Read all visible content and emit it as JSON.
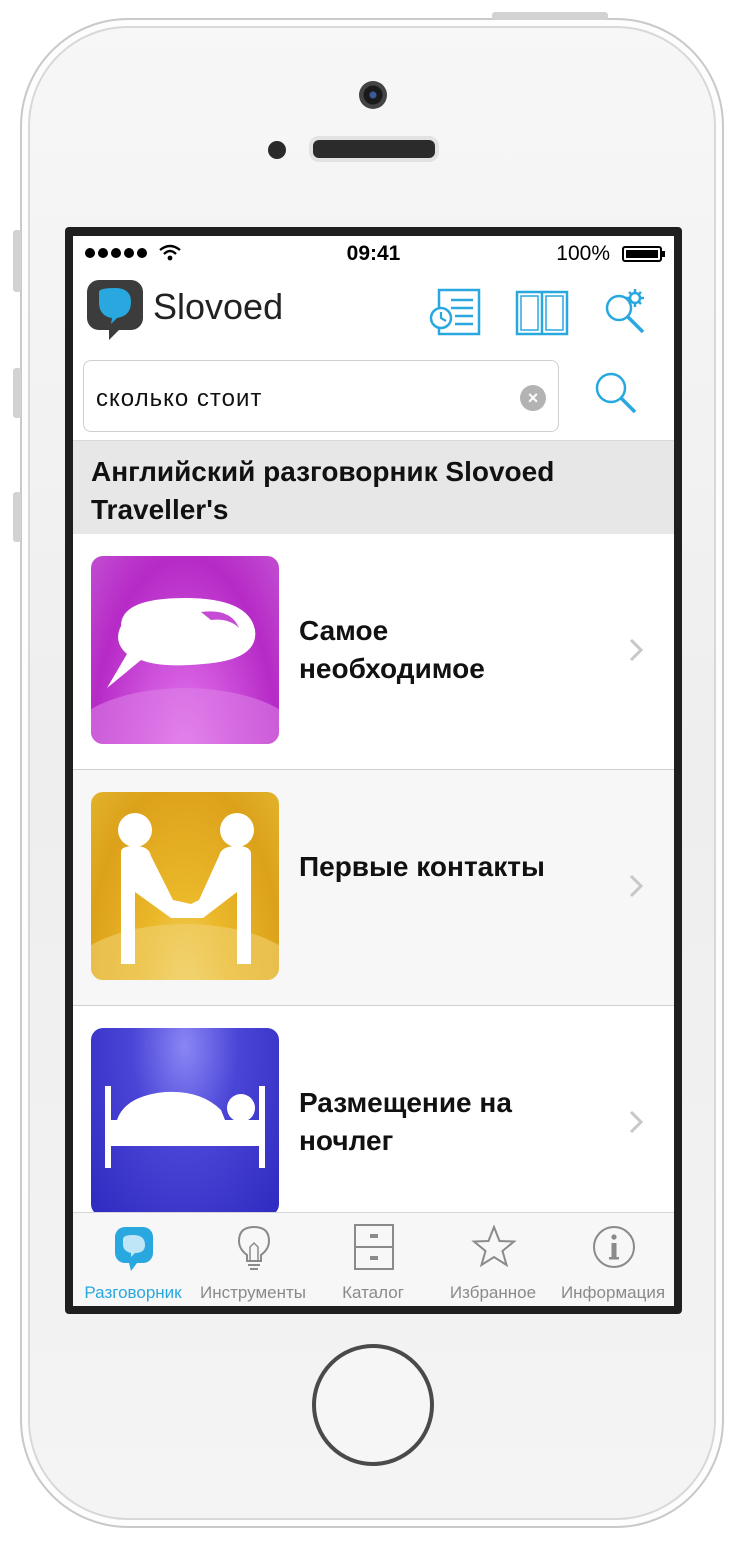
{
  "status_bar": {
    "time": "09:41",
    "battery": "100%"
  },
  "app": {
    "brand": "Slovoed"
  },
  "toolbar": {
    "history_icon": "history-list-icon",
    "book_icon": "book-icon",
    "settings_search_icon": "search-settings-icon"
  },
  "search": {
    "value": "сколько стоит",
    "clear_icon": "clear-icon",
    "button_icon": "search-icon"
  },
  "section": {
    "title": "Английский разговорник Slovoed Traveller's"
  },
  "categories": [
    {
      "title_line1": "Самое",
      "title_line2": "необходимое",
      "icon": "speech-bubble-icon",
      "color": "#c83fd6"
    },
    {
      "title_line1": "Первые контакты",
      "title_line2": "",
      "icon": "handshake-icon",
      "color": "#e6b021"
    },
    {
      "title_line1": "Размещение на",
      "title_line2": "ночлег",
      "icon": "bed-icon",
      "color": "#4a45d6"
    }
  ],
  "tabs": [
    {
      "label": "Разговорник",
      "icon": "chat-bubble-icon",
      "active": true
    },
    {
      "label": "Инструменты",
      "icon": "lightbulb-icon",
      "active": false
    },
    {
      "label": "Каталог",
      "icon": "cabinet-icon",
      "active": false
    },
    {
      "label": "Избранное",
      "icon": "star-icon",
      "active": false
    },
    {
      "label": "Информация",
      "icon": "info-icon",
      "active": false
    }
  ],
  "colors": {
    "accent": "#29a8e0",
    "section_bg": "#e7e7e7"
  }
}
